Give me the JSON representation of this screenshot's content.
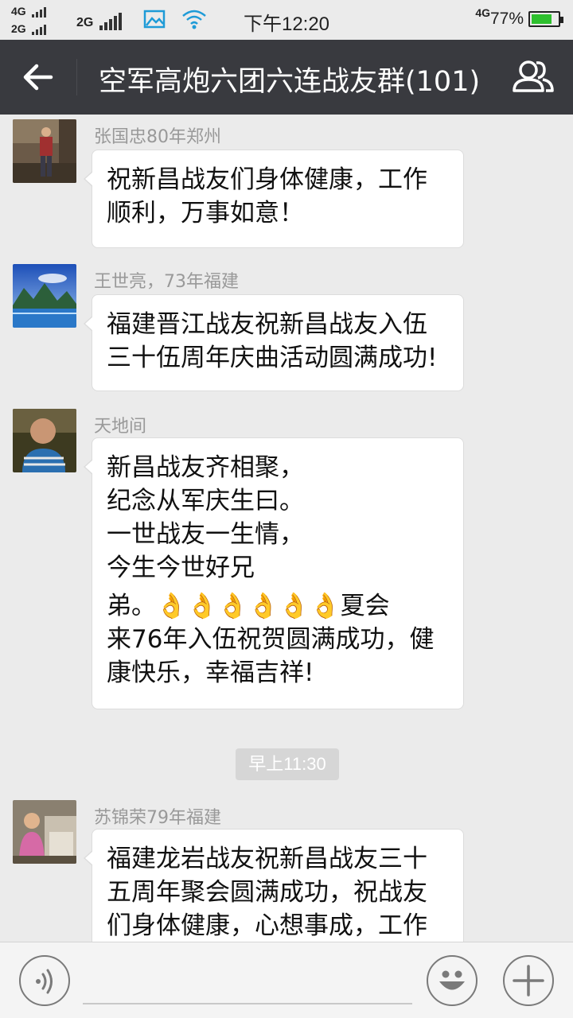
{
  "status_bar": {
    "sim1_net": "4G",
    "sim2_net": "2G",
    "sim3_net": "2G",
    "time": "下午12:20",
    "data_net": "4G",
    "battery_percent": "77%",
    "battery_level": 0.77
  },
  "header": {
    "title": "空军高炮六团六连战友群(101)",
    "back_icon": "arrow-left-icon",
    "members_icon": "group-members-icon"
  },
  "messages": [
    {
      "sender": "张国忠80年郑州",
      "lines": [
        "祝新昌战友们身体健康，工作",
        "顺利，万事如意！"
      ]
    },
    {
      "sender": "王世亮，73年福建",
      "lines": [
        "福建晋江战友祝新昌战友入伍",
        "三十伍周年庆曲活动圆满成功!"
      ]
    },
    {
      "sender": "天地间",
      "lines": [
        "新昌战友齐相聚，",
        "纪念从军庆生曰。",
        "一世战友一生情，",
        "今生今世好兄",
        "弟。👌👌👌👌👌👌夏会",
        "来76年入伍祝贺圆满成功，健",
        "康快乐，幸福吉祥!"
      ]
    },
    {
      "sender": "苏锦荣79年福建",
      "lines": [
        "福建龙岩战友祝新昌战友三十",
        "五周年聚会圆满成功，祝战友",
        "们身体健康，心想事成，工作"
      ]
    }
  ],
  "timestamp": "早上11:30",
  "input_bar": {
    "voice_icon": "voice-icon",
    "emoji_icon": "emoji-icon",
    "plus_icon": "plus-icon",
    "input_value": ""
  },
  "colors": {
    "titlebar": "#393a3f",
    "background": "#ebebeb",
    "battery": "#2ec02e"
  }
}
